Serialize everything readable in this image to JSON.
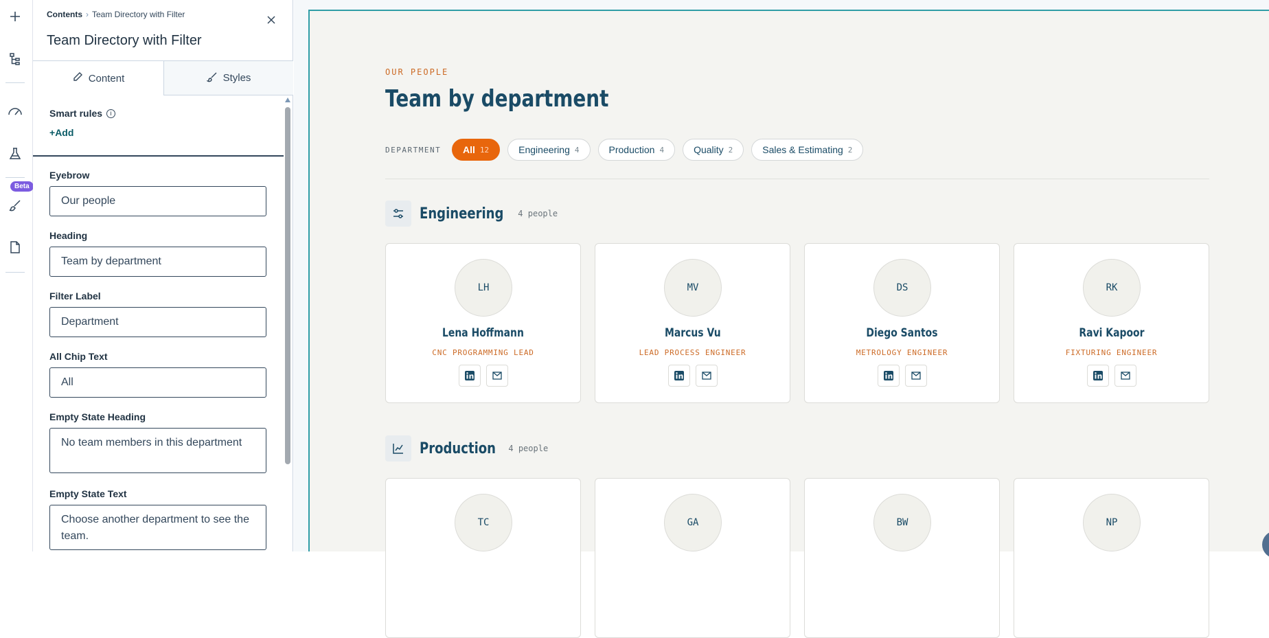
{
  "editor": {
    "breadcrumb": {
      "root": "Contents",
      "current": "Team Directory with Filter"
    },
    "title": "Team Directory with Filter",
    "tabs": [
      {
        "label": "Content",
        "icon": "pencil-icon"
      },
      {
        "label": "Styles",
        "icon": "brush-icon"
      }
    ],
    "smart_rules": {
      "label": "Smart rules",
      "add": "Add"
    },
    "fields": [
      {
        "label": "Eyebrow",
        "value": "Our people"
      },
      {
        "label": "Heading",
        "value": "Team by department"
      },
      {
        "label": "Filter Label",
        "value": "Department"
      },
      {
        "label": "All Chip Text",
        "value": "All"
      },
      {
        "label": "Empty State Heading",
        "value": "No team members in this department"
      },
      {
        "label": "Empty State Text",
        "value": "Choose another department to see the team."
      }
    ]
  },
  "rail": {
    "beta": "Beta",
    "icons": [
      "plus-icon",
      "tree-icon",
      "gauge-icon",
      "flask-icon",
      "brush-icon",
      "page-icon"
    ]
  },
  "preview": {
    "eyebrow": "OUR PEOPLE",
    "heading": "Team by department",
    "filter_label": "DEPARTMENT",
    "chips": [
      {
        "label": "All",
        "count": "12",
        "active": true
      },
      {
        "label": "Engineering",
        "count": "4"
      },
      {
        "label": "Production",
        "count": "4"
      },
      {
        "label": "Quality",
        "count": "2"
      },
      {
        "label": "Sales & Estimating",
        "count": "2"
      }
    ],
    "departments": [
      {
        "name": "Engineering",
        "count": "4 people",
        "icon": "sliders-icon",
        "members": [
          {
            "initials": "LH",
            "name": "Lena Hoffmann",
            "role": "CNC PROGRAMMING LEAD"
          },
          {
            "initials": "MV",
            "name": "Marcus Vu",
            "role": "LEAD PROCESS ENGINEER"
          },
          {
            "initials": "DS",
            "name": "Diego Santos",
            "role": "METROLOGY ENGINEER"
          },
          {
            "initials": "RK",
            "name": "Ravi Kapoor",
            "role": "FIXTURING ENGINEER"
          }
        ]
      },
      {
        "name": "Production",
        "count": "4 people",
        "icon": "chart-icon",
        "members": [
          {
            "initials": "TC"
          },
          {
            "initials": "GA"
          },
          {
            "initials": "BW"
          },
          {
            "initials": "NP"
          }
        ]
      }
    ]
  },
  "colors": {
    "accent": "#e8660c",
    "navy": "#1a4b66",
    "role": "#cc6a25",
    "frame": "#2f9da6"
  }
}
